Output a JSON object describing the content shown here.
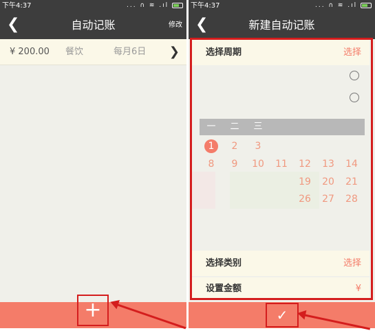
{
  "left": {
    "status": {
      "time": "下午4:37",
      "icons": "... ∩ ≋ .ıl"
    },
    "title": "自动记账",
    "action": "修改",
    "entry": {
      "amount": "¥ 200.00",
      "category": "餐饮",
      "schedule": "每月6日"
    },
    "add_glyph": "+"
  },
  "right": {
    "status": {
      "time": "下午4:37",
      "icons": "... ∩ ≋ .ıl"
    },
    "title": "新建自动记账",
    "period": {
      "label": "选择周期",
      "value": "选择"
    },
    "weekdays": [
      "一",
      "二",
      "三"
    ],
    "days_row1": [
      "1",
      "2",
      "3"
    ],
    "days_row2": [
      "8",
      "9",
      "10",
      "11",
      "12",
      "13",
      "14"
    ],
    "days_row3": [
      "19",
      "20",
      "21"
    ],
    "days_row4": [
      "26",
      "27",
      "28"
    ],
    "category": {
      "label": "选择类别",
      "value": "选择"
    },
    "amount": {
      "label": "设置金额",
      "value": "¥"
    },
    "confirm_glyph": "✓"
  },
  "colors": {
    "accent": "#f47c69",
    "header": "#3d3d3d",
    "highlight": "#d41d1d"
  }
}
